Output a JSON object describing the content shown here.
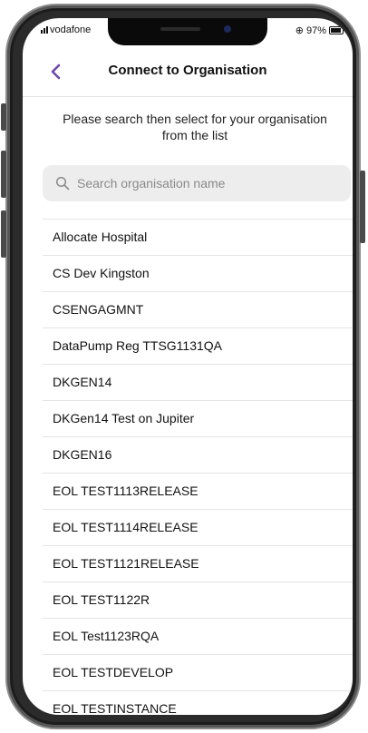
{
  "status_bar": {
    "carrier": "vodafone",
    "battery": "97%"
  },
  "header": {
    "title": "Connect to Organisation",
    "back_icon": "chevron-left-icon",
    "accent_color": "#6b4aa8"
  },
  "instructions": "Please search then select for your organisation from the list",
  "search": {
    "placeholder": "Search organisation name",
    "value": ""
  },
  "organisations": [
    "Allocate Hospital",
    "CS Dev Kingston",
    "CSENGAGMNT",
    "DataPump Reg TTSG1131QA",
    "DKGEN14",
    "DKGen14 Test on Jupiter",
    "DKGEN16",
    "EOL TEST1113RELEASE",
    "EOL TEST1114RELEASE",
    "EOL TEST1121RELEASE",
    "EOL TEST1122R",
    "EOL Test1123RQA",
    "EOL TESTDEVELOP",
    "EOL TESTINSTANCE"
  ]
}
